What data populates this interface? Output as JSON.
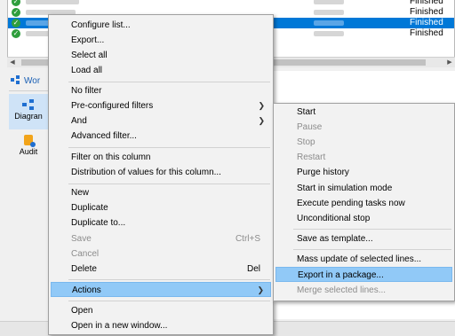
{
  "background": {
    "rows": [
      {
        "status": "Finished",
        "selected": false
      },
      {
        "status": "Finished",
        "selected": false
      },
      {
        "status": "Finished",
        "selected": true
      },
      {
        "status": "Finished",
        "selected": false
      }
    ],
    "tab_label": "Wor",
    "sidebar": {
      "diagram_label": "Diagran",
      "audit_label": "Audit"
    }
  },
  "context_menu": {
    "configure": "Configure list...",
    "export": "Export...",
    "select_all": "Select all",
    "load_all": "Load all",
    "no_filter": "No filter",
    "preconfigured_filters": "Pre-configured filters",
    "and": "And",
    "advanced_filter": "Advanced filter...",
    "filter_column": "Filter on this column",
    "distribution": "Distribution of values for this column...",
    "new": "New",
    "duplicate": "Duplicate",
    "duplicate_to": "Duplicate to...",
    "save": "Save",
    "save_shortcut": "Ctrl+S",
    "cancel": "Cancel",
    "delete": "Delete",
    "delete_shortcut": "Del",
    "actions": "Actions",
    "open": "Open",
    "open_new_window": "Open in a new window..."
  },
  "actions_submenu": {
    "start": "Start",
    "pause": "Pause",
    "stop": "Stop",
    "restart": "Restart",
    "purge_history": "Purge history",
    "start_simulation": "Start in simulation mode",
    "execute_pending": "Execute pending tasks now",
    "unconditional_stop": "Unconditional stop",
    "save_template": "Save as template...",
    "mass_update": "Mass update of selected lines...",
    "export_package": "Export in a package...",
    "merge_lines": "Merge selected lines..."
  },
  "colors": {
    "selection_blue": "#0078d7",
    "menu_highlight": "#91c9f7",
    "check_green": "#2e9e3c"
  }
}
